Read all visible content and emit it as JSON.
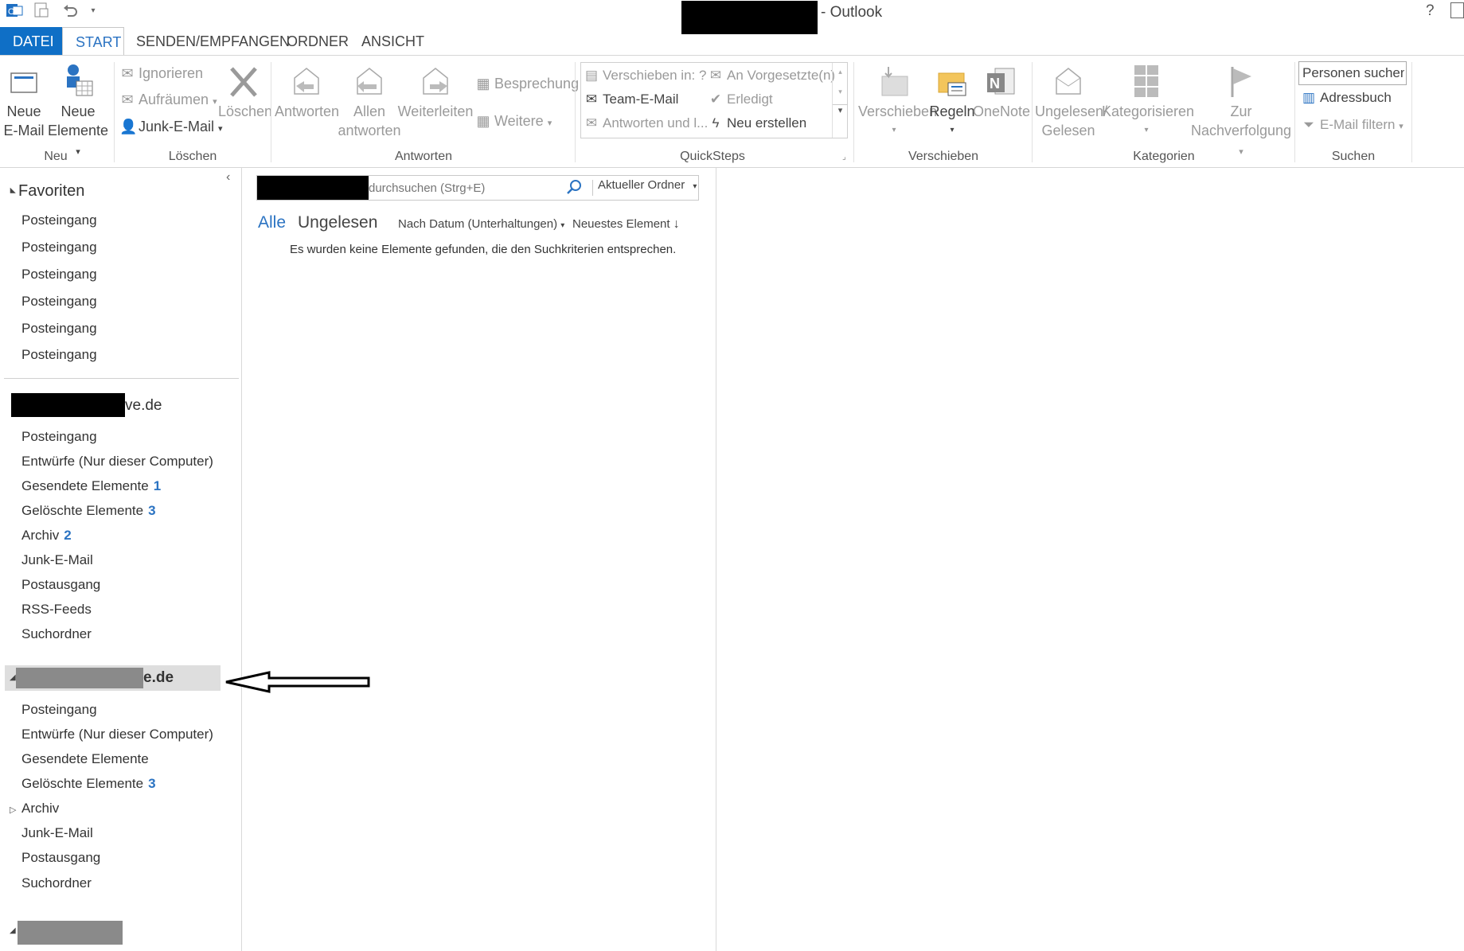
{
  "window": {
    "title": "- Outlook",
    "help": "?"
  },
  "tabs": [
    {
      "label": "DATEI"
    },
    {
      "label": "START"
    },
    {
      "label": "SENDEN/EMPFANGEN"
    },
    {
      "label": "ORDNER"
    },
    {
      "label": "ANSICHT"
    }
  ],
  "ribbon": {
    "neu": {
      "group": "Neu",
      "new_email": [
        "Neue",
        "E-Mail"
      ],
      "new_items": [
        "Neue",
        "Elemente"
      ]
    },
    "loeschen": {
      "group": "Löschen",
      "ignore": "Ignorieren",
      "cleanup": "Aufräumen",
      "junk": "Junk-E-Mail",
      "delete": "Löschen"
    },
    "antworten": {
      "group": "Antworten",
      "reply": "Antworten",
      "reply_all": [
        "Allen",
        "antworten"
      ],
      "forward": "Weiterleiten",
      "meeting": "Besprechung",
      "more": "Weitere"
    },
    "quicksteps": {
      "group": "QuickSteps",
      "move_to": "Verschieben in: ?",
      "to_manager": "An Vorgesetzte(n)",
      "team_email": "Team-E-Mail",
      "done": "Erledigt",
      "reply_delete": "Antworten und l...",
      "create_new": "Neu erstellen"
    },
    "verschieben": {
      "group": "Verschieben",
      "move": "Verschieben",
      "rules": "Regeln",
      "onenote": "OneNote"
    },
    "kategorien": {
      "group": "Kategorien",
      "unread_read": [
        "Ungelesen/",
        "Gelesen"
      ],
      "categorize": "Kategorisieren",
      "followup": [
        "Zur",
        "Nachverfolgung"
      ]
    },
    "suchen": {
      "group": "Suchen",
      "people_search": "Personen suchen",
      "address_book": "Adressbuch",
      "filter_email": "E-Mail filtern"
    }
  },
  "nav": {
    "favorites_header": "Favoriten",
    "favorites": [
      "Posteingang",
      "Posteingang",
      "Posteingang",
      "Posteingang",
      "Posteingang",
      "Posteingang"
    ],
    "account1": {
      "suffix": "ve.de",
      "folders": [
        {
          "label": "Posteingang",
          "count": ""
        },
        {
          "label": "Entwürfe (Nur dieser Computer)",
          "count": ""
        },
        {
          "label": "Gesendete Elemente",
          "count": "1"
        },
        {
          "label": "Gelöschte Elemente",
          "count": "3"
        },
        {
          "label": "Archiv",
          "count": "2"
        },
        {
          "label": "Junk-E-Mail",
          "count": ""
        },
        {
          "label": "Postausgang",
          "count": ""
        },
        {
          "label": "RSS-Feeds",
          "count": ""
        },
        {
          "label": "Suchordner",
          "count": ""
        }
      ]
    },
    "account2": {
      "suffix": "e.de",
      "folders": [
        {
          "label": "Posteingang",
          "count": ""
        },
        {
          "label": "Entwürfe (Nur dieser Computer)",
          "count": ""
        },
        {
          "label": "Gesendete Elemente",
          "count": ""
        },
        {
          "label": "Gelöschte Elemente",
          "count": "3"
        },
        {
          "label": "Archiv",
          "count": ""
        },
        {
          "label": "Junk-E-Mail",
          "count": ""
        },
        {
          "label": "Postausgang",
          "count": ""
        },
        {
          "label": "Suchordner",
          "count": ""
        }
      ]
    }
  },
  "list": {
    "search_placeholder": "durchsuchen (Strg+E)",
    "scope": "Aktueller Ordner",
    "filter_all": "Alle",
    "filter_unread": "Ungelesen",
    "sort_by": "Nach Datum (Unterhaltungen)",
    "sort_order": "Neuestes Element",
    "empty_message": "Es wurden keine Elemente gefunden, die den Suchkriterien entsprechen."
  },
  "colors": {
    "accent": "#2b73c2",
    "file_tab": "#0f6fc6"
  }
}
